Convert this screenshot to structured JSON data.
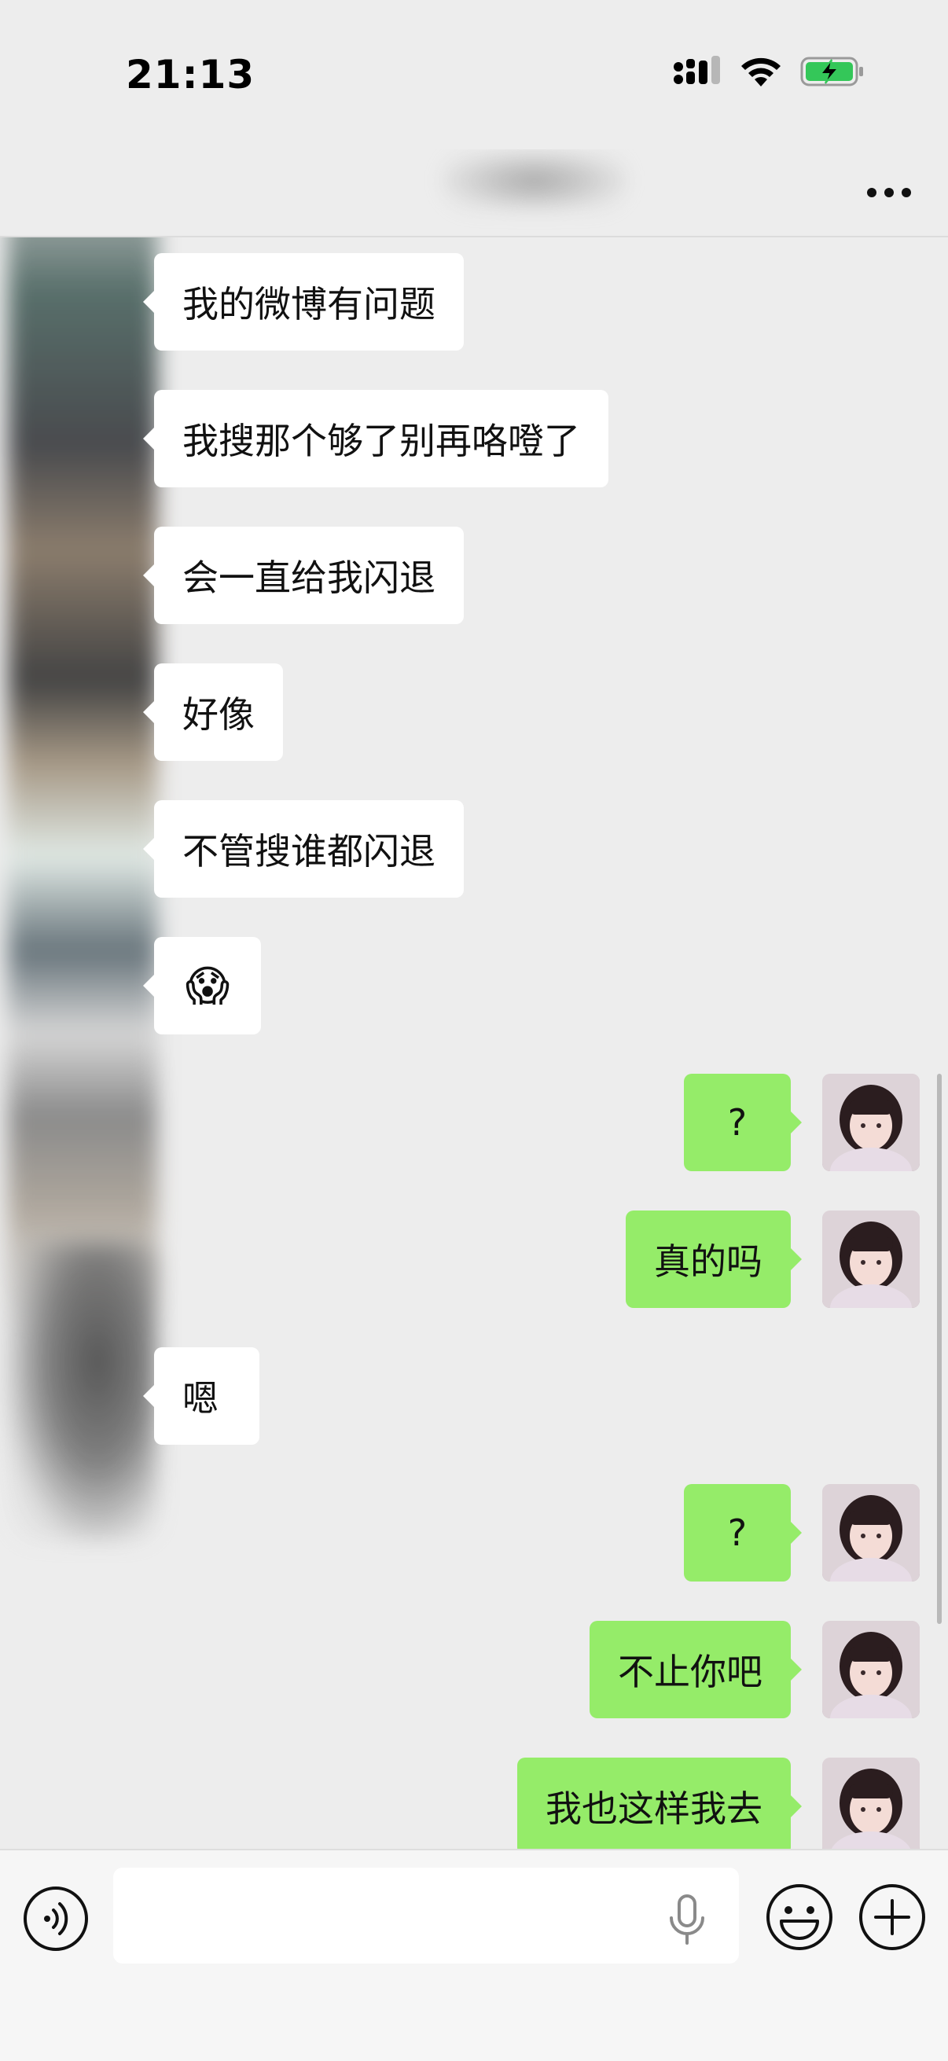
{
  "status_bar": {
    "time": "21:13"
  },
  "header": {
    "more_icon": "more-icon"
  },
  "messages": [
    {
      "side": "in",
      "text": "我的微博有问题"
    },
    {
      "side": "in",
      "text": "我搜那个够了别再咯噔了"
    },
    {
      "side": "in",
      "text": "会一直给我闪退"
    },
    {
      "side": "in",
      "text": "好像"
    },
    {
      "side": "in",
      "text": "不管搜谁都闪退"
    },
    {
      "side": "in",
      "text": "😱"
    },
    {
      "side": "out",
      "text": "?"
    },
    {
      "side": "out",
      "text": "真的吗"
    },
    {
      "side": "in",
      "text": "嗯"
    },
    {
      "side": "out",
      "text": "?"
    },
    {
      "side": "out",
      "text": "不止你吧"
    },
    {
      "side": "out",
      "text": "我也这样我去"
    }
  ],
  "input_bar": {
    "placeholder": "",
    "voice_icon": "voice-icon",
    "mic_icon": "mic-icon",
    "emoji_icon": "emoji-icon",
    "plus_icon": "plus-icon"
  },
  "colors": {
    "background": "#ededed",
    "incoming_bubble": "#ffffff",
    "outgoing_bubble": "#95ec69",
    "battery_charging": "#34c759"
  }
}
